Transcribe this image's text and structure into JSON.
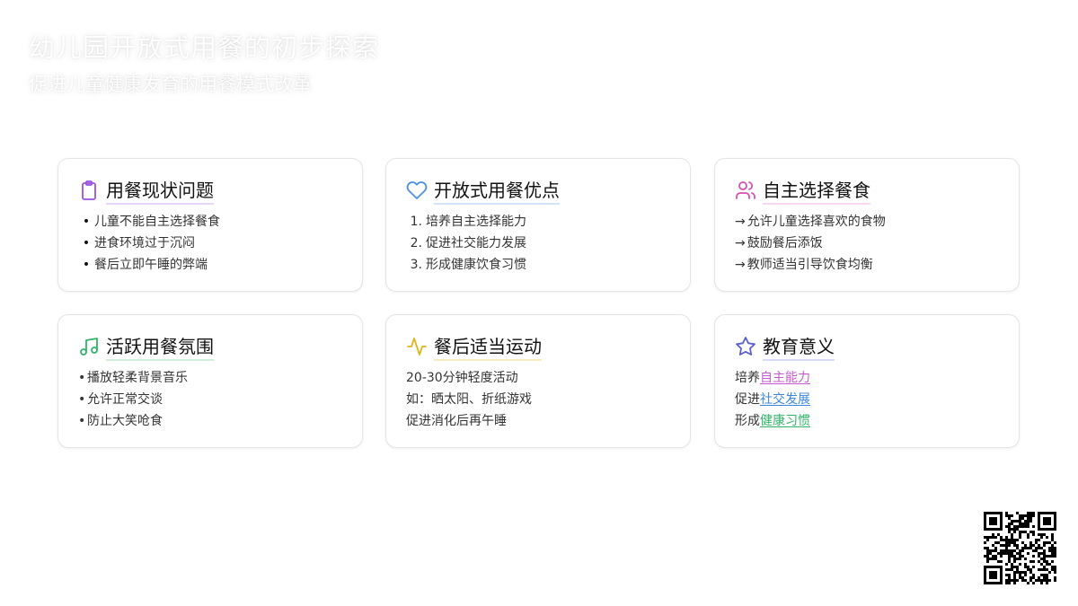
{
  "header": {
    "title": "幼儿园开放式用餐的初步探索",
    "subtitle": "促进儿童健康发育的用餐模式改革"
  },
  "cards": [
    {
      "title": "用餐现状问题",
      "icon": "clipboard-icon",
      "accent": "#9b51e0",
      "underline": "#e6d6fb",
      "items": [
        "儿童不能自主选择餐食",
        "进食环境过于沉闷",
        "餐后立即午睡的弊端"
      ]
    },
    {
      "title": "开放式用餐优点",
      "icon": "heart-icon",
      "accent": "#4a8fe7",
      "underline": "#d3e3fb",
      "items": [
        "培养自主选择能力",
        "促进社交能力发展",
        "形成健康饮食习惯"
      ],
      "numbers": [
        "1.",
        "2.",
        "3."
      ]
    },
    {
      "title": "自主选择餐食",
      "icon": "users-icon",
      "accent": "#d64fb0",
      "underline": "#f9d7ee",
      "arrow": "→",
      "items": [
        "允许儿童选择喜欢的食物",
        "鼓励餐后添饭",
        "教师适当引导饮食均衡"
      ]
    },
    {
      "title": "活跃用餐氛围",
      "icon": "music-note-icon",
      "accent": "#2fb567",
      "underline": "#cfeedb",
      "dot": "•",
      "items": [
        "播放轻柔背景音乐",
        "允许正常交谈",
        "防止大笑呛食"
      ]
    },
    {
      "title": "餐后适当运动",
      "icon": "activity-icon",
      "accent": "#e0b319",
      "underline": "#f8ebbd",
      "items": [
        "20-30分钟轻度活动",
        "如：晒太阳、折纸游戏",
        "促进消化后再午睡"
      ]
    },
    {
      "title": "教育意义",
      "icon": "star-icon",
      "accent": "#5a5fd6",
      "underline": "#d9daf6",
      "lines": [
        {
          "prefix": "培养",
          "link": "自主能力",
          "color": "#c55bd0"
        },
        {
          "prefix": "促进",
          "link": "社交发展",
          "color": "#3a86e0"
        },
        {
          "prefix": "形成",
          "link": "健康习惯",
          "color": "#2fb567"
        }
      ]
    }
  ],
  "qr_code": {
    "icon": "qr-code-icon"
  }
}
